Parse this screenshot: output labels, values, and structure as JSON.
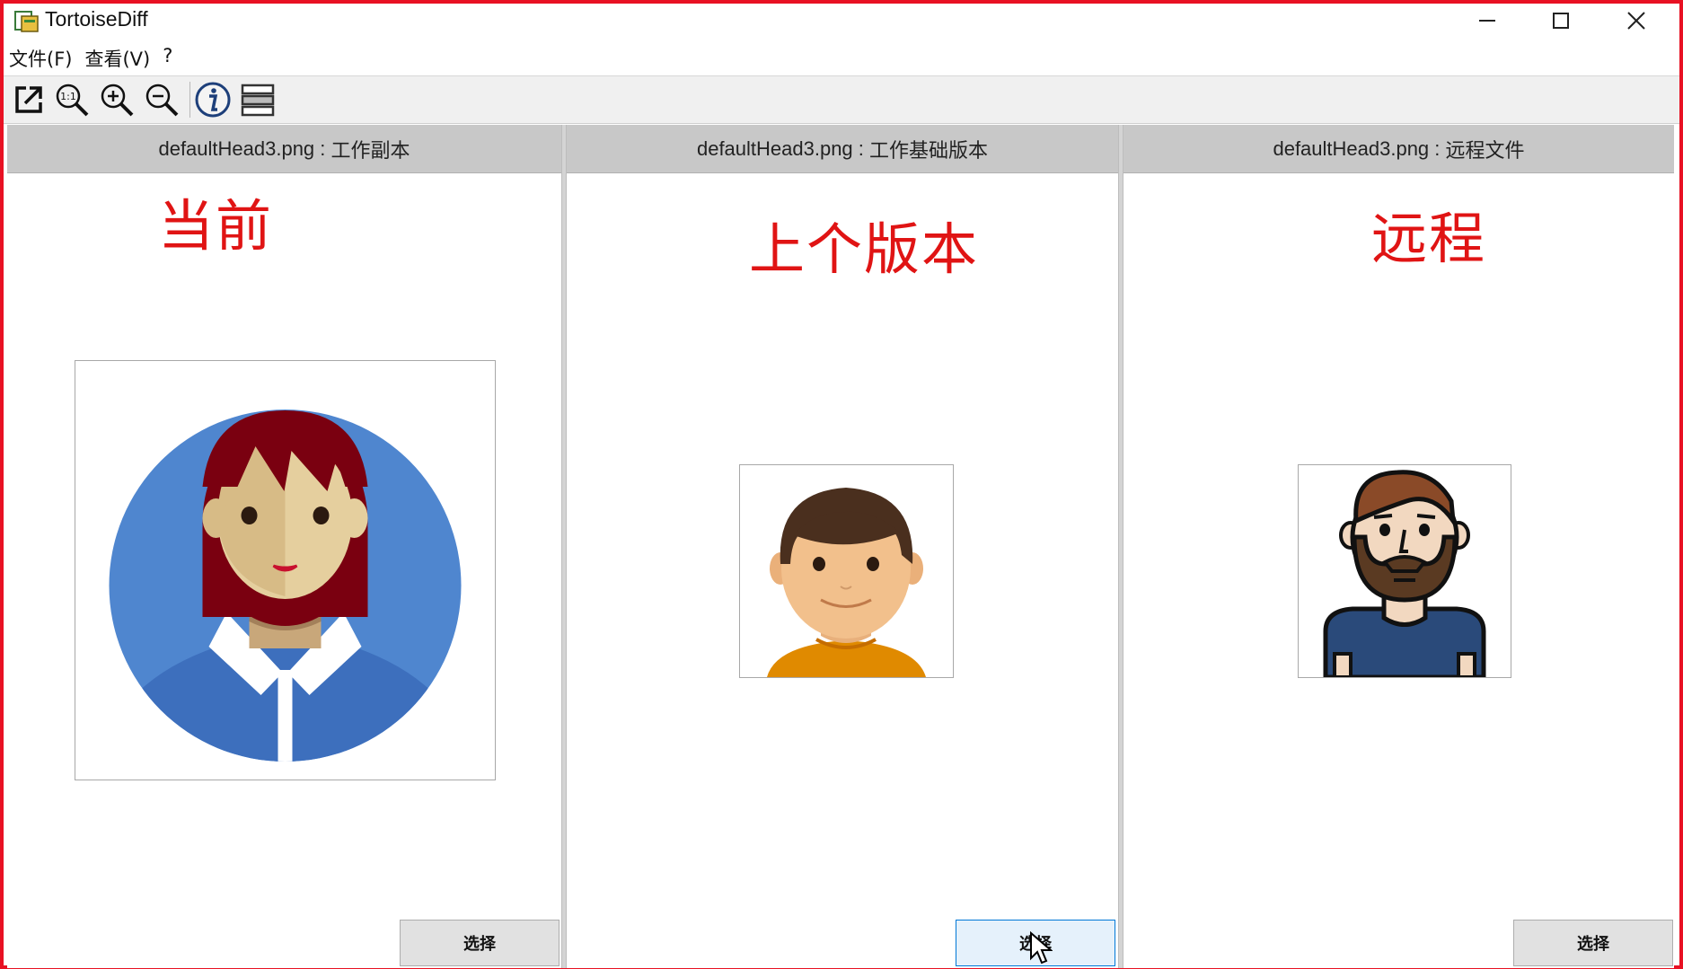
{
  "window": {
    "title": "TortoiseDiff",
    "minimize": "—",
    "maximize": "☐",
    "close": "✕"
  },
  "menu": {
    "file": "文件(F)",
    "view": "查看(V)",
    "help": "?"
  },
  "toolbar": {
    "items": [
      "open-external",
      "actual-size-1:1",
      "zoom-in",
      "zoom-out",
      "image-info",
      "overlay-mode"
    ]
  },
  "panes": [
    {
      "filename": "defaultHead3.png",
      "role": "工作副本",
      "annotation": "当前",
      "button": "选择"
    },
    {
      "filename": "defaultHead3.png",
      "role": "工作基础版本",
      "annotation": "上个版本",
      "button": "选择"
    },
    {
      "filename": "defaultHead3.png",
      "role": "远程文件",
      "annotation": "远程",
      "button": "选择"
    }
  ],
  "colors": {
    "border": "#e81123",
    "annotation": "#e01414",
    "header": "#c8c8c8"
  }
}
